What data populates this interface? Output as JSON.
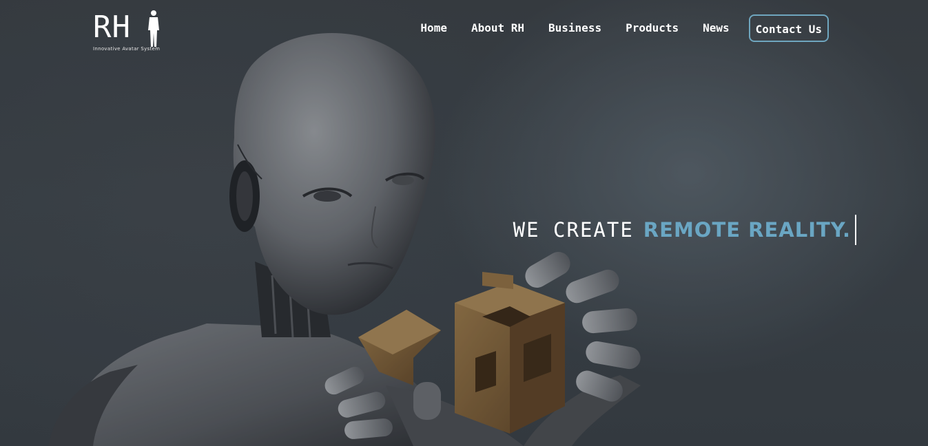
{
  "brand": {
    "logo_text": "RH",
    "tagline": "Innovative Avatar System"
  },
  "nav": {
    "items": [
      {
        "label": "Home"
      },
      {
        "label": "About RH"
      },
      {
        "label": "Business"
      },
      {
        "label": "Products"
      },
      {
        "label": "News"
      }
    ],
    "cta_label": "Contact Us"
  },
  "hero": {
    "headline_white": "WE CREATE",
    "headline_accent": "REMOTE REALITY.",
    "image_subject": "humanoid-robot-holding-wooden-puzzle-cube"
  },
  "colors": {
    "accent": "#6aa6c3",
    "cta_border": "#6fa6bf",
    "background": "#3a3f44",
    "text": "#ffffff"
  }
}
